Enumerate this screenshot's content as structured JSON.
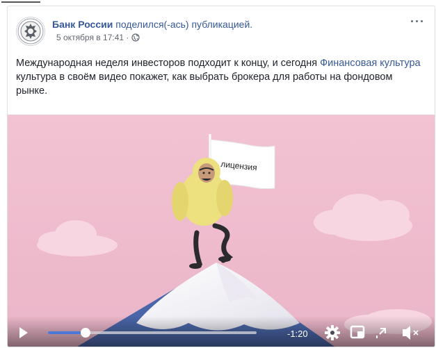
{
  "post": {
    "author": "Банк России",
    "shared_text": "поделился(-ась) публикацией.",
    "timestamp": "5 октября в 17:41 ·",
    "more_label": "···",
    "text_part1": "Международная неделя инвесторов подходит к концу, и сегодня ",
    "link_text": "Финансовая культура",
    "text_part2": " культура в своём видео покажет, как выбрать брокера для работы на фондовом рынке."
  },
  "video": {
    "flag_text": "лицензия",
    "time_remaining": "-1:20",
    "progress": 0.18,
    "colors": {
      "sky": "#f0bccd",
      "character": "#ece07f",
      "mountain": "#4a66a8",
      "snow": "#f6f5f8"
    }
  },
  "icons": {
    "play": "play-icon",
    "settings": "gear-icon",
    "mini": "miniplayer-icon",
    "fullscreen": "fullscreen-icon",
    "mute": "mute-icon",
    "globe": "globe-icon"
  }
}
